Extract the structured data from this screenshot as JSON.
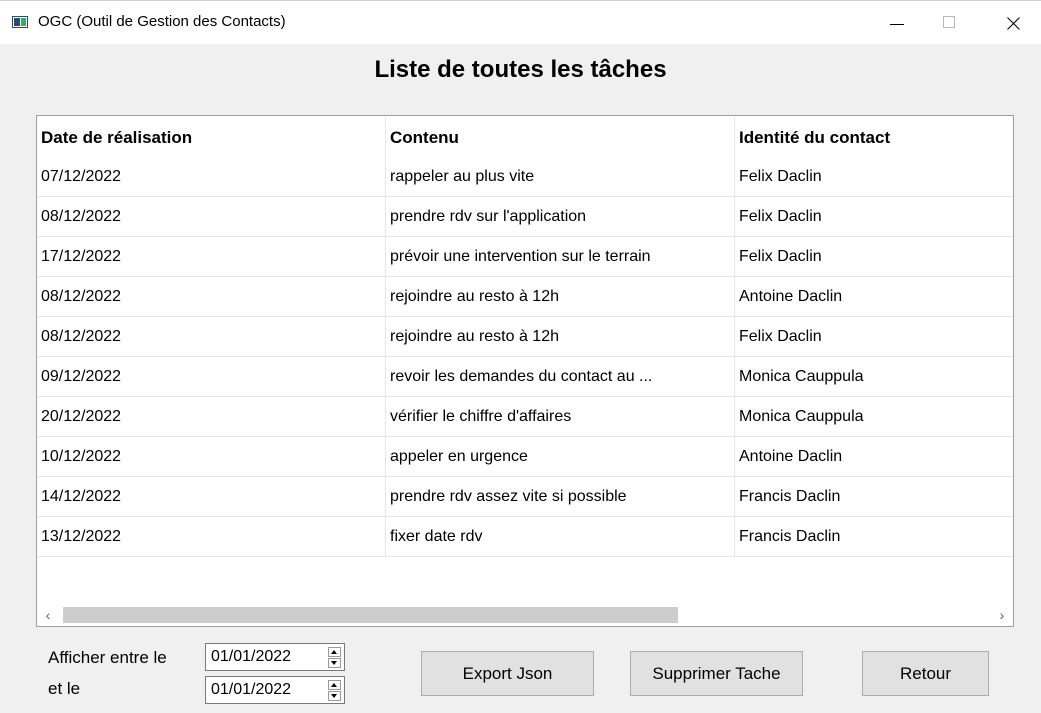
{
  "window": {
    "title": "OGC (Outil de Gestion des Contacts)"
  },
  "page_title": "Liste de toutes les tâches",
  "table": {
    "columns": [
      "Date de réalisation",
      "Contenu",
      "Identité du contact"
    ],
    "rows": [
      [
        "07/12/2022",
        "rappeler au plus vite",
        "Felix Daclin"
      ],
      [
        "08/12/2022",
        "prendre rdv sur l'application",
        "Felix Daclin"
      ],
      [
        "17/12/2022",
        "prévoir une intervention sur le terrain",
        "Felix Daclin"
      ],
      [
        "08/12/2022",
        "rejoindre au resto à 12h",
        "Antoine Daclin"
      ],
      [
        "08/12/2022",
        "rejoindre au resto à 12h",
        "Felix Daclin"
      ],
      [
        "09/12/2022",
        "revoir les demandes du contact au ...",
        "Monica Cauppula"
      ],
      [
        "20/12/2022",
        "vérifier le chiffre d'affaires",
        "Monica Cauppula"
      ],
      [
        "10/12/2022",
        "appeler en urgence",
        "Antoine Daclin"
      ],
      [
        "14/12/2022",
        "prendre rdv assez vite si possible",
        "Francis Daclin"
      ],
      [
        "13/12/2022",
        "fixer date rdv",
        "Francis Daclin"
      ]
    ]
  },
  "filter": {
    "from_label": "Afficher entre le",
    "to_label": "et le",
    "from_date": "01/01/2022",
    "to_date": "01/01/2022"
  },
  "buttons": {
    "export": "Export Json",
    "delete": "Supprimer Tache",
    "back": "Retour"
  },
  "icons": {
    "scroll_left": "‹",
    "scroll_right": "›"
  }
}
